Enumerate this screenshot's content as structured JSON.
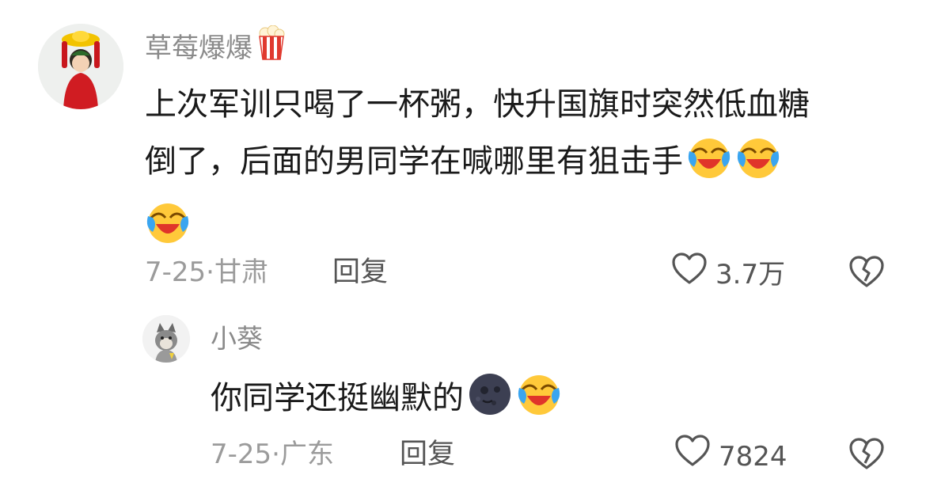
{
  "comment": {
    "username": "草莓爆爆",
    "username_badge_icon": "popcorn-icon",
    "text_lines": [
      "上次军训只喝了一杯粥，快升国旗时突然低血糖",
      "倒了，后面的男同学在喊哪里有狙击手"
    ],
    "date": "7-25",
    "separator": "·",
    "location": "甘肃",
    "reply_label": "回复",
    "likes": "3.7万"
  },
  "reply": {
    "username": "小葵",
    "text": "你同学还挺幽默的",
    "date": "7-25",
    "separator": "·",
    "location": "广东",
    "reply_label": "回复",
    "likes": "7824"
  },
  "colors": {
    "username": "#8a8a8a",
    "text": "#1a1a1a",
    "meta": "#9b9b9b",
    "action": "#555555"
  }
}
